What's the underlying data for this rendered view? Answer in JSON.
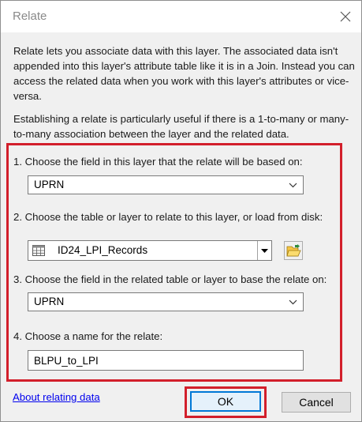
{
  "dialog": {
    "title": "Relate",
    "close_icon": "close-icon"
  },
  "description": {
    "para1": "Relate lets you associate data with this layer. The associated data isn't appended into this layer's attribute table like it is in a Join. Instead you can access the related data when you work with this layer's attributes or vice-versa.",
    "para2": "Establishing a relate is particularly useful if there is a 1-to-many or many-to-many association between the layer and the related data."
  },
  "steps": {
    "step1": {
      "label": "1. Choose the field in this layer that the relate will be based on:",
      "value": "UPRN"
    },
    "step2": {
      "label": "2. Choose the table or layer to relate to this layer, or load from disk:",
      "value": "ID24_LPI_Records",
      "table_icon": "table-icon",
      "browse_icon": "open-folder-icon"
    },
    "step3": {
      "label": "3. Choose the field in the related table or layer to base the relate on:",
      "value": "UPRN"
    },
    "step4": {
      "label": "4. Choose a name for the relate:",
      "value": "BLPU_to_LPI"
    }
  },
  "footer": {
    "help_link": "About relating data",
    "ok_label": "OK",
    "cancel_label": "Cancel"
  },
  "colors": {
    "highlight_red": "#d21f2b",
    "link_blue": "#0000ee",
    "focus_blue": "#0078d7"
  }
}
